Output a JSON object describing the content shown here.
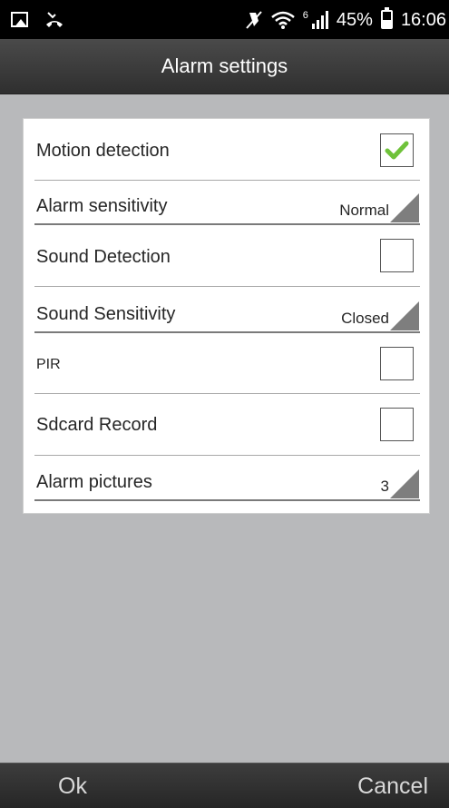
{
  "status_bar": {
    "battery": "45%",
    "time": "16:06",
    "network": "6",
    "icons": [
      "image-icon",
      "missed-call-icon",
      "mute-icon",
      "wifi-icon",
      "signal-icon",
      "battery-icon"
    ]
  },
  "header": {
    "title": "Alarm settings"
  },
  "settings": {
    "motion_detection": {
      "label": "Motion detection",
      "checked": true
    },
    "alarm_sensitivity": {
      "label": "Alarm sensitivity",
      "value": "Normal"
    },
    "sound_detection": {
      "label": "Sound Detection",
      "checked": false
    },
    "sound_sensitivity": {
      "label": "Sound Sensitivity",
      "value": "Closed"
    },
    "pir": {
      "label": "PIR",
      "checked": false
    },
    "sdcard_record": {
      "label": "Sdcard Record",
      "checked": false
    },
    "alarm_pictures": {
      "label": "Alarm pictures",
      "value": "3"
    }
  },
  "footer": {
    "ok_label": "Ok",
    "cancel_label": "Cancel"
  },
  "colors": {
    "check": "#6fc23a",
    "title_bar": "#3a3a3a",
    "background": "#b8b9bb"
  }
}
